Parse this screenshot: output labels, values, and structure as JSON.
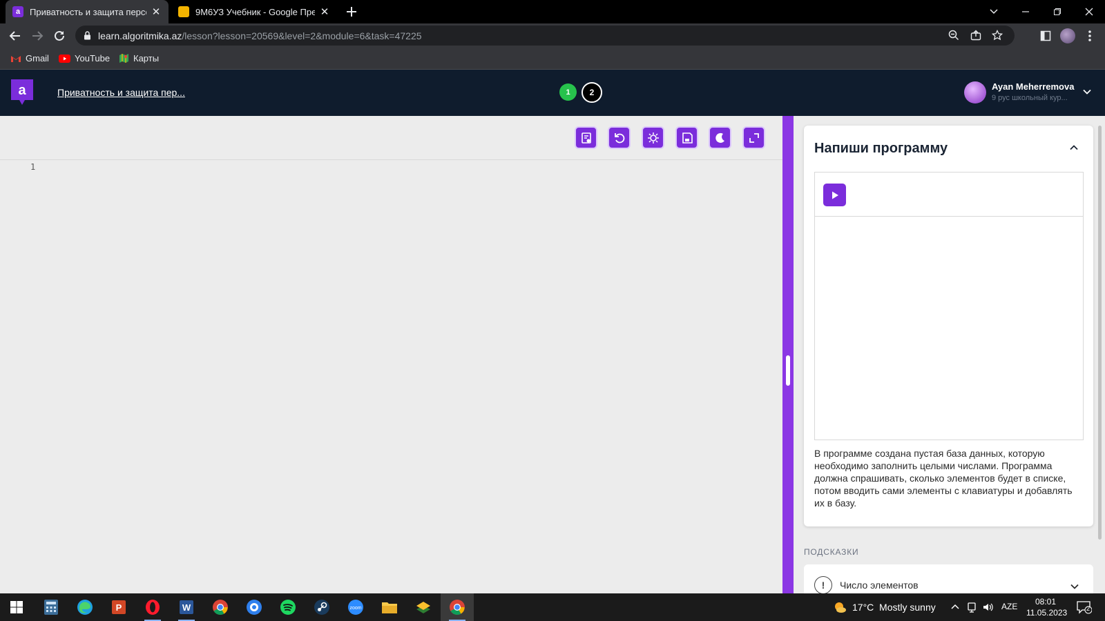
{
  "browser": {
    "tabs": [
      {
        "title": "Приватность и защита персона",
        "favicon": "a",
        "active": true
      },
      {
        "title": "9М6УЗ Учебник - Google Презе",
        "favicon": "slides",
        "active": false
      }
    ],
    "url_host": "learn.algoritmika.az",
    "url_path": "/lesson?lesson=20569&level=2&module=6&task=47225",
    "bookmarks": [
      {
        "label": "Gmail",
        "icon": "gmail-icon"
      },
      {
        "label": "YouTube",
        "icon": "youtube-icon"
      },
      {
        "label": "Карты",
        "icon": "maps-icon"
      }
    ]
  },
  "app": {
    "logo_letter": "a",
    "lesson_title": "Приватность и защита пер...",
    "steps": [
      "1",
      "2"
    ],
    "current_step": "2",
    "user": {
      "name": "Ayan Meherremova",
      "course": "9 рус школьный кур..."
    },
    "colors": {
      "accent": "#7b2ddb",
      "header_bg": "#0f1c2d",
      "step_done": "#27c24c"
    }
  },
  "editor": {
    "toolbar_icons": [
      "dictionary-icon",
      "reset-icon",
      "debug-icon",
      "save-icon",
      "dark-mode-icon",
      "fullscreen-icon"
    ],
    "line_number": "1"
  },
  "task": {
    "title": "Напиши программу",
    "description": "В программе создана пустая база данных, которую необходимо заполнить целыми числами. Программа должна спрашивать, сколько элементов будет в списке, потом вводить сами элементы с клавиатуры и добавлять их в базу.",
    "hints_label": "ПОДСКАЗКИ",
    "hint_title": "Число элементов"
  },
  "taskbar": {
    "weather": "17°C  Mostly sunny",
    "language": "AZE",
    "time": "08:01",
    "date": "11.05.2023",
    "notification_count": "2"
  }
}
